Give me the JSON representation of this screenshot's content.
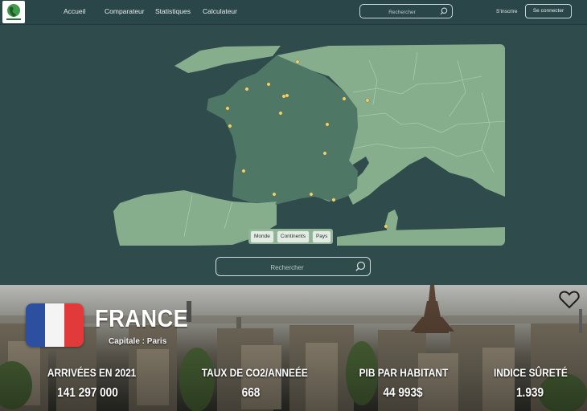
{
  "nav": {
    "links": [
      "Accueil",
      "Comparateur",
      "Statistiques",
      "Calculateur"
    ],
    "search_placeholder": "Rechercher",
    "signup_label": "S'inscrire",
    "login_label": "Se connecter"
  },
  "map": {
    "toggle": [
      "Monde",
      "Continents",
      "Pays"
    ],
    "search_placeholder": "Rechercher",
    "colors": {
      "land": "#86ad8c",
      "selected": "#4e7766",
      "sea": "#2f4b4b",
      "marker": "#f0d36a"
    }
  },
  "country": {
    "name": "FRANCE",
    "capital": "Capitale : Paris",
    "flag_colors": [
      "#2d4fa0",
      "#f4f4f4",
      "#e23a3a"
    ]
  },
  "stats": [
    {
      "label": "ARRIVÉES EN 2021",
      "value": "141 297 000"
    },
    {
      "label": "TAUX DE CO2/ANNEÉE",
      "value": "668"
    },
    {
      "label": "PIB PAR HABITANT",
      "value": "44 993$"
    },
    {
      "label": "INDICE SÛRETÉ",
      "value": "1.939"
    }
  ]
}
